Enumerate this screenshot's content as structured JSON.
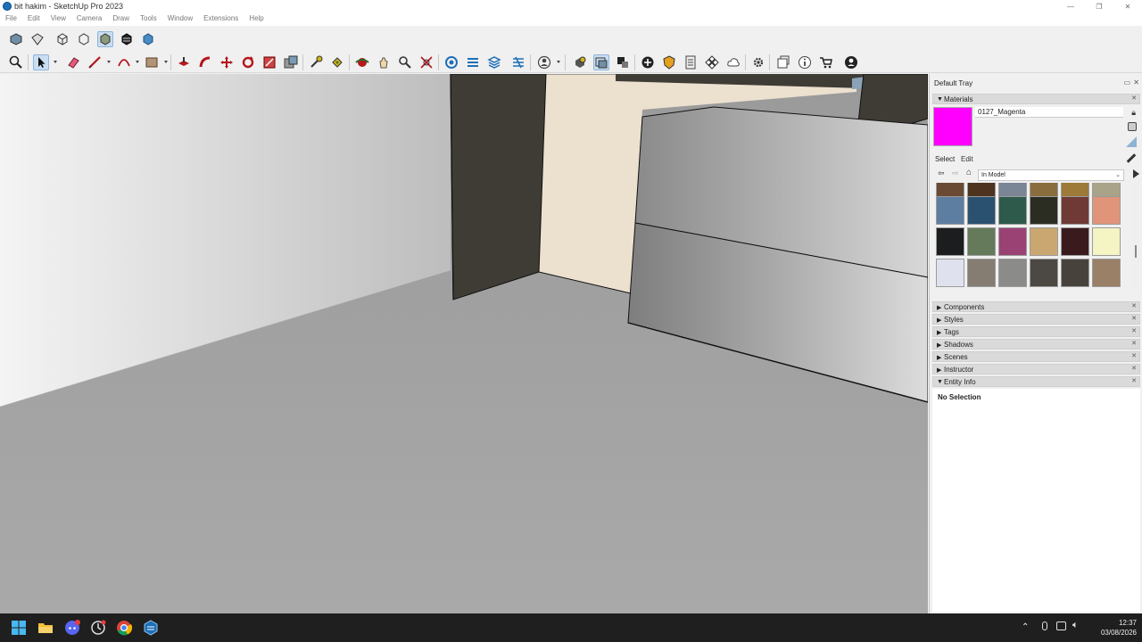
{
  "window": {
    "title": "bit hakim - SketchUp Pro 2023",
    "controls": [
      "—",
      "❐",
      "✕"
    ]
  },
  "menu": [
    "File",
    "Edit",
    "View",
    "Camera",
    "Draw",
    "Tools",
    "Window",
    "Extensions",
    "Help"
  ],
  "toolbar1_icons": [
    "iso-view-icon",
    "top-view-icon",
    "front-view-icon",
    "wireframe-icon",
    "shaded-icon",
    "shaded-textures-icon",
    "monochrome-icon"
  ],
  "tray": {
    "title": "Default Tray",
    "materials": {
      "section_label": "Materials",
      "current_name": "0127_Magenta",
      "current_color": "#ff00ff",
      "tab_select": "Select",
      "tab_edit": "Edit",
      "library": "In Model",
      "swatch_rows": [
        [
          "#6b4a35",
          "#4d3320",
          "#7a8595",
          "#8a6d3e",
          "#9d7a37",
          "#a8a389"
        ],
        [
          "#5e7ea1",
          "#2b5171",
          "#2e5a4b",
          "#2c2d22",
          "#6f3a36",
          "#e0957b"
        ],
        [
          "#1b1d1f",
          "#647a5a",
          "#9b4274",
          "#caa770",
          "#3a1a1d",
          "#f4f4c4"
        ],
        [
          "#dfe2ee",
          "#857c72",
          "#8b8b8a",
          "#4c4843",
          "#47433c",
          "#9a8066"
        ]
      ]
    },
    "panels": [
      "Components",
      "Styles",
      "Tags",
      "Shadows",
      "Scenes",
      "Instructor",
      "Entity Info"
    ],
    "entity_info": "No Selection"
  },
  "taskbar": {
    "time": "12:37",
    "date": "03/08/2026",
    "apps": [
      "windows-start-icon",
      "file-explorer-icon",
      "discord-icon",
      "clock-app-icon",
      "chrome-icon",
      "sketchup-icon"
    ]
  }
}
